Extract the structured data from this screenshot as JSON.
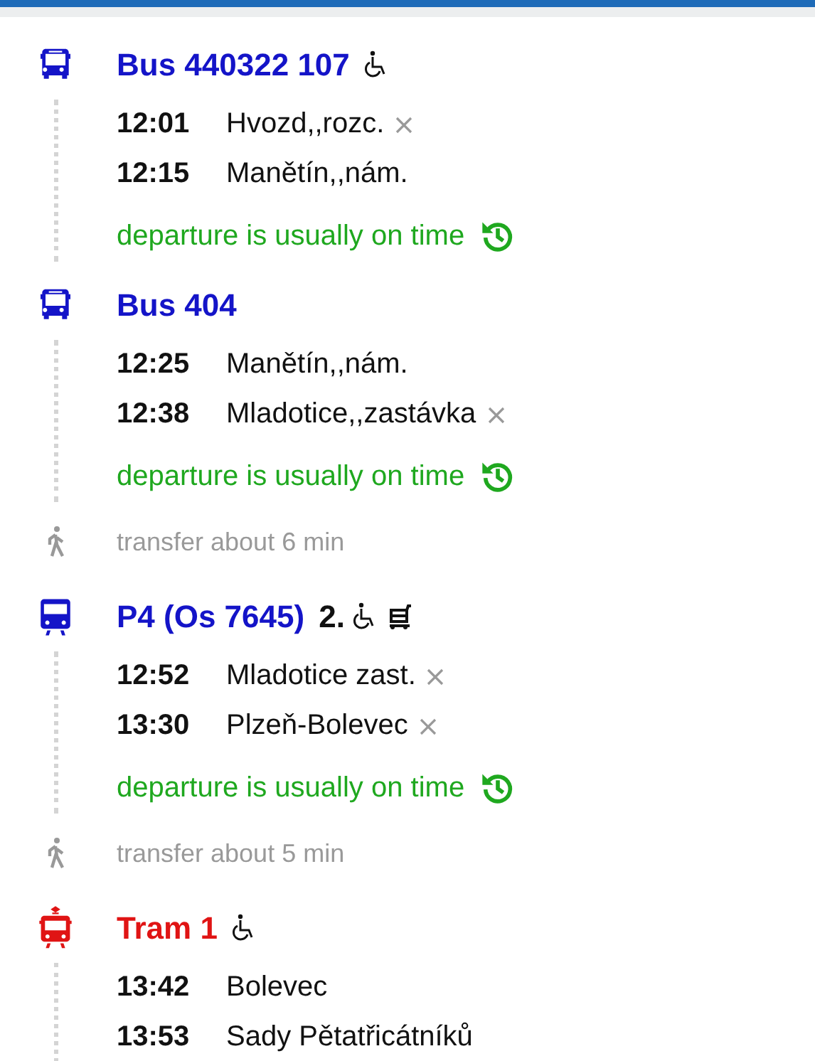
{
  "legs": [
    {
      "kind": "bus",
      "color": "#1414c8",
      "title": "Bus 440322 107",
      "features": [
        {
          "kind": "wheelchair"
        }
      ],
      "stops": [
        {
          "time": "12:01",
          "name": "Hvozd,,rozc.",
          "request_stop": true
        },
        {
          "time": "12:15",
          "name": "Manětín,,nám.",
          "request_stop": false
        }
      ],
      "punctuality": "departure is usually on time"
    },
    {
      "kind": "bus",
      "color": "#1414c8",
      "title": "Bus 404",
      "stops": [
        {
          "time": "12:25",
          "name": "Manětín,,nám.",
          "request_stop": false
        },
        {
          "time": "12:38",
          "name": "Mladotice,,zastávka",
          "request_stop": true
        }
      ],
      "punctuality": "departure is usually on time"
    },
    {
      "kind": "walk",
      "text": "transfer about 6 min"
    },
    {
      "kind": "train",
      "color": "#1414c8",
      "title": "P4 (Os 7645)",
      "class_label": "2.",
      "features": [
        {
          "kind": "wheelchair"
        },
        {
          "kind": "cart"
        }
      ],
      "stops": [
        {
          "time": "12:52",
          "name": "Mladotice zast.",
          "request_stop": true
        },
        {
          "time": "13:30",
          "name": "Plzeň-Bolevec",
          "request_stop": true
        }
      ],
      "punctuality": "departure is usually on time"
    },
    {
      "kind": "walk",
      "text": "transfer about 5 min"
    },
    {
      "kind": "tram",
      "color": "#e01414",
      "title": "Tram 1",
      "features": [
        {
          "kind": "wheelchair"
        }
      ],
      "stops": [
        {
          "time": "13:42",
          "name": "Bolevec",
          "request_stop": false
        },
        {
          "time": "13:53",
          "name": "Sady Pětatřicátníků",
          "request_stop": false
        }
      ]
    }
  ]
}
